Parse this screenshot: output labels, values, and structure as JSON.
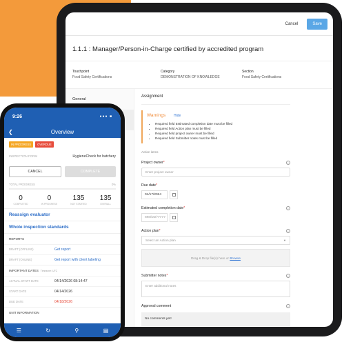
{
  "tablet": {
    "cancel_label": "Cancel",
    "save_label": "Save",
    "title": "1.1.1 : Manager/Person-in-Charge certified by accredited program",
    "meta": [
      {
        "label": "Touchpoint",
        "value": "Food Safety Certifications"
      },
      {
        "label": "Category",
        "value": "DEMONSTRATION OF KNOWLEDGE"
      },
      {
        "label": "Section",
        "value": "Food Safety Certifications"
      }
    ],
    "sidebar": [
      {
        "label": "General"
      },
      {
        "label": "Assignment"
      }
    ],
    "section_title": "Assignment",
    "warnings": {
      "title": "Warnings",
      "hide": "Hide",
      "items": [
        "Required field Estimated completion date must be filled",
        "Required field Action plan must be filled",
        "Required field project owner must be filled",
        "Required field Submitter notes must be filled"
      ]
    },
    "action_items_label": "Action items",
    "project_owner": {
      "label": "Project owner",
      "placeholder": "Enter project owner"
    },
    "due_date": {
      "label": "Due date",
      "value": "01/17/2024"
    },
    "est_completion": {
      "label": "Estimated completion date",
      "placeholder": "MM/DD/YYYY"
    },
    "action_plan": {
      "label": "Action plan",
      "placeholder": "Select an Action plan"
    },
    "drop": {
      "text": "Drag & Drop file(s) here or",
      "browse": "Browse"
    },
    "submitter_notes": {
      "label": "Submitter notes",
      "placeholder": "Enter additional notes"
    },
    "approval": {
      "label": "Approval comment",
      "value": "No comments yet!"
    }
  },
  "phone": {
    "time": "9:26",
    "signal": "●●● ■",
    "title": "Overview",
    "badges": [
      "IN PROGRESS",
      "OVERDUE"
    ],
    "inspection_form": {
      "label": "INSPECTION FORM",
      "value": "HygieneCheck for hatchery"
    },
    "cancel": "CANCEL",
    "complete": "COMPLETE",
    "total_progress": "TOTAL PROGRESS",
    "progress_pct": "0%",
    "stats": [
      {
        "n": "0",
        "l": "COMPLETED"
      },
      {
        "n": "0",
        "l": "IN PROGRESS"
      },
      {
        "n": "135",
        "l": "NOT STARTED"
      },
      {
        "n": "135",
        "l": "OVERALL"
      }
    ],
    "reassign": "Reassign evaluator",
    "whole": "Whole inspection standards",
    "reports": "REPORTS",
    "draft_offline": {
      "k": "DRAFT (OFFLINE)",
      "v": "Get report"
    },
    "draft_online": {
      "k": "DRAFT (ONLINE)",
      "v": "Get report with client labeling"
    },
    "important_dates": "IMPORTANT DATES",
    "timezone": "Timezone: UTC",
    "actual_start": {
      "k": "ACTUAL START DATE",
      "v": "04/14/2026 08:14:47"
    },
    "start_date": {
      "k": "START DATE",
      "v": "04/14/2026"
    },
    "due_date": {
      "k": "DUE DATE",
      "v": "04/18/2026"
    },
    "unit_info": "UNIT INFORMATION"
  }
}
